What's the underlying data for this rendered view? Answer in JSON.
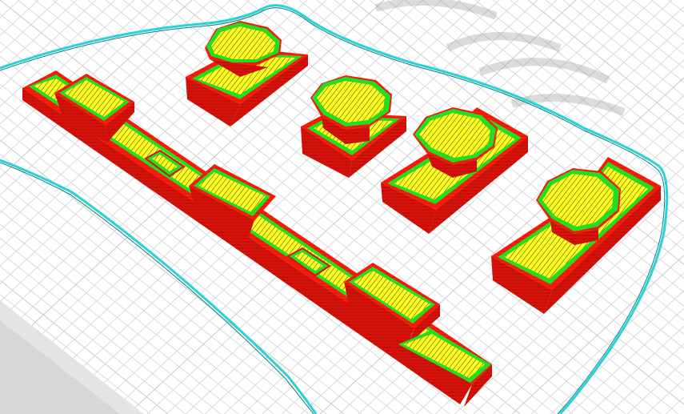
{
  "viewport": {
    "view_mode": "layer-preview",
    "colors": {
      "background": "#ffffff",
      "build_plate": "#f3f3f3",
      "grid_line": "#d9d9d9",
      "grid_major": "#c9c9c9",
      "skirt": "#27d3d6",
      "wall_outer": "#ff1a0a",
      "wall_outer_shade": "#c70e04",
      "wall_inner": "#22dd22",
      "infill": "#ffff22",
      "infill_hatch": "#4a4a00",
      "watermark": "#bdbdbd"
    },
    "objects": [
      {
        "name": "long-bar-part",
        "type": "part"
      },
      {
        "name": "top-octagon-part",
        "type": "part"
      },
      {
        "name": "center-octagon-part",
        "type": "part"
      },
      {
        "name": "right-octagon-part",
        "type": "part"
      },
      {
        "name": "far-right-octagon-part",
        "type": "part"
      }
    ]
  }
}
